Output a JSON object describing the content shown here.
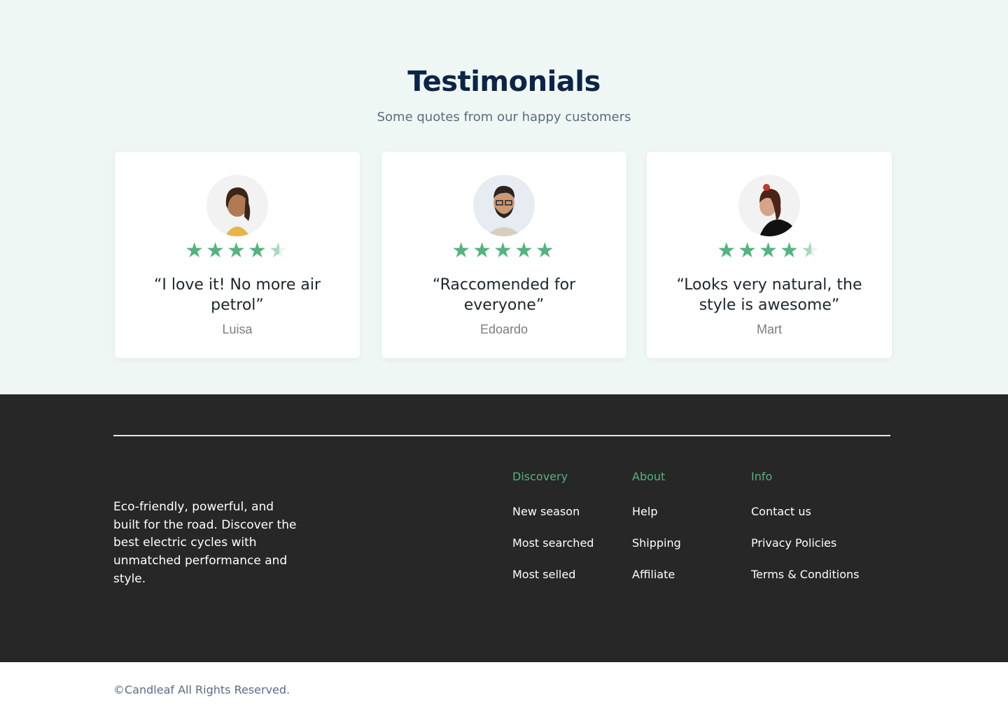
{
  "testimonials": {
    "title": "Testimonials",
    "subtitle": "Some quotes from our happy customers",
    "star_color": "#56b280",
    "cards": [
      {
        "quote": "“I love it! No more air petrol”",
        "author": "Luisa",
        "rating": 4.5
      },
      {
        "quote": "“Raccomended for everyone”",
        "author": "Edoardo",
        "rating": 5
      },
      {
        "quote": "“Looks very natural, the style is awesome”",
        "author": "Mart",
        "rating": 4.5
      }
    ]
  },
  "footer": {
    "description": "Eco-friendly, powerful, and built for the road. Discover the best electric cycles with unmatched performance and style.",
    "accent_color": "#56b280",
    "columns": [
      {
        "heading": "Discovery",
        "links": [
          "New season",
          "Most searched",
          "Most selled"
        ]
      },
      {
        "heading": "About",
        "links": [
          "Help",
          "Shipping",
          "Affiliate"
        ]
      },
      {
        "heading": "Info",
        "links": [
          "Contact us",
          "Privacy Policies",
          "Terms & Conditions"
        ]
      }
    ]
  },
  "copyright": "©Candleaf All Rights Reserved."
}
